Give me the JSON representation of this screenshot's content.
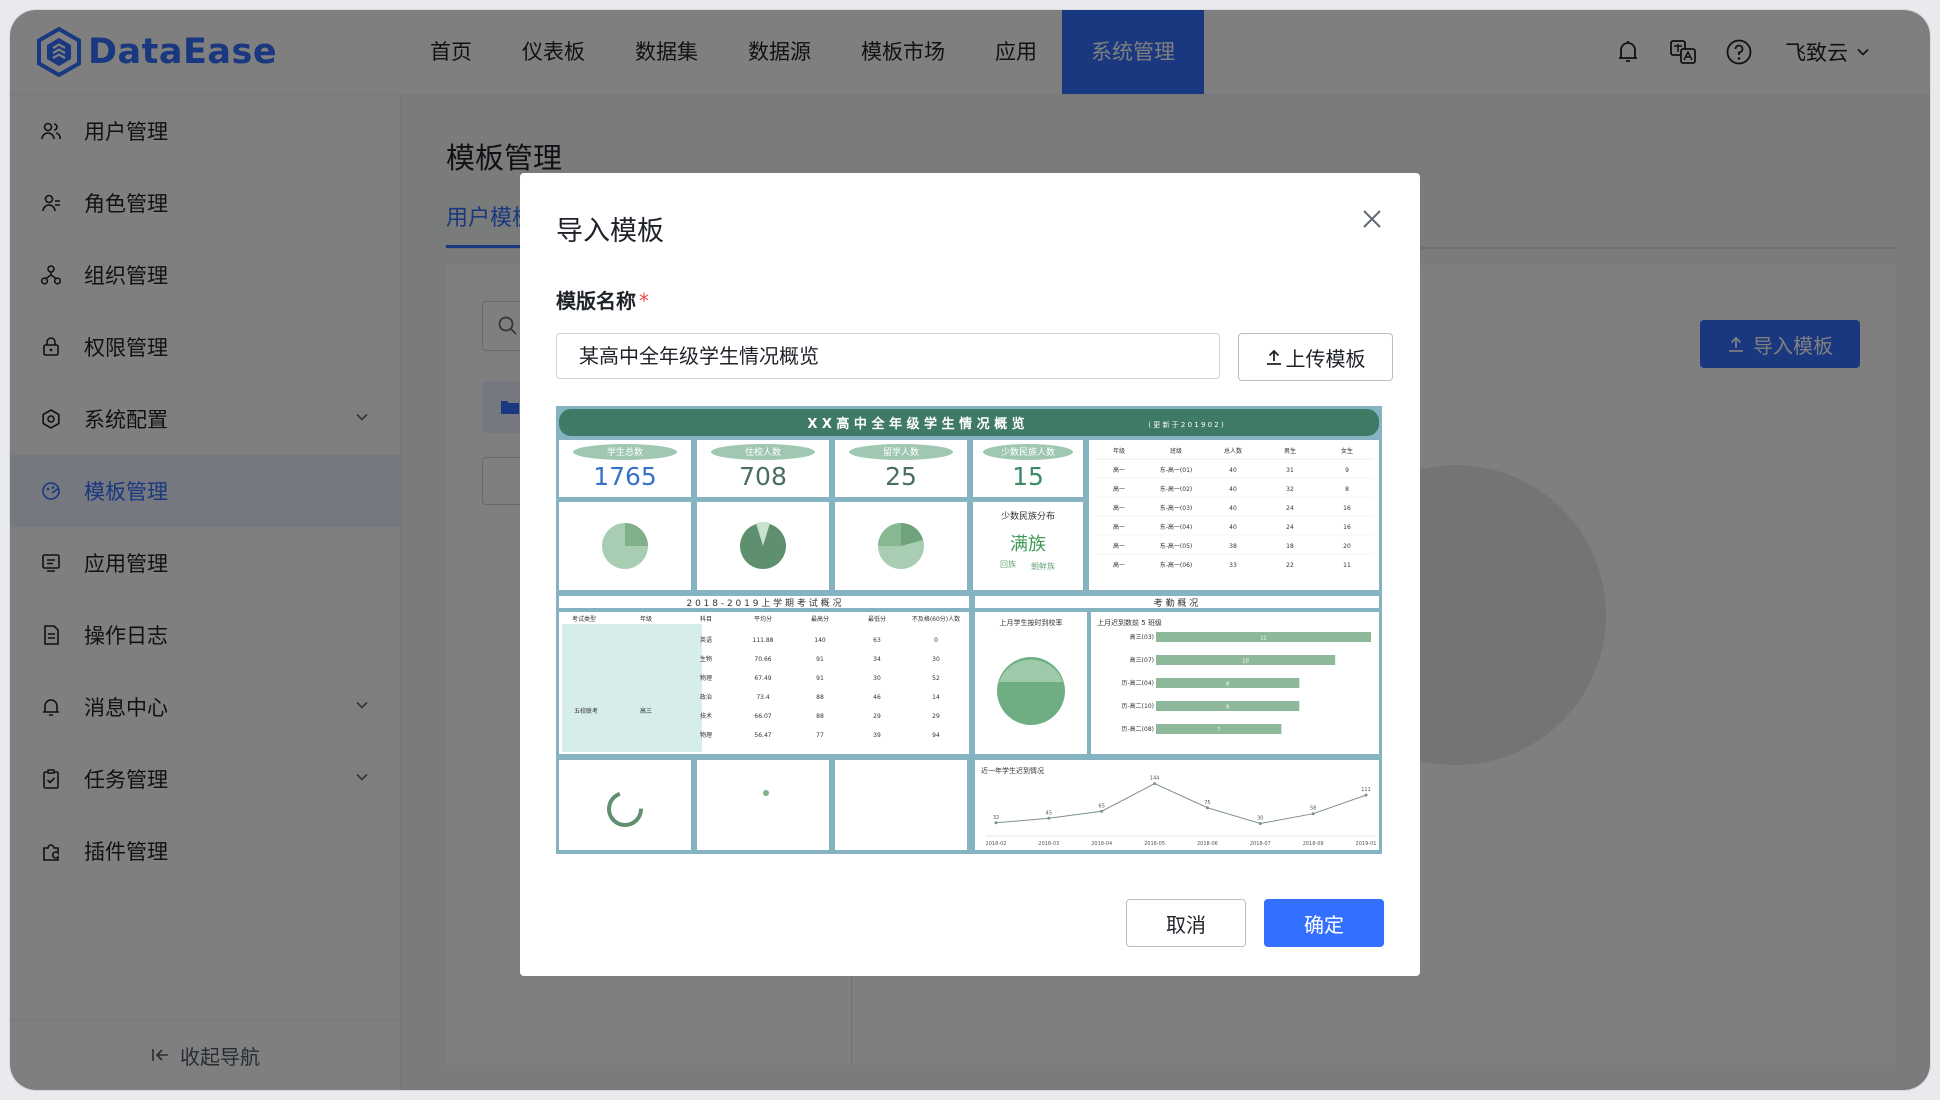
{
  "app": {
    "logo_text": "DataEase"
  },
  "nav": {
    "items": [
      "首页",
      "仪表板",
      "数据集",
      "数据源",
      "模板市场",
      "应用",
      "系统管理"
    ],
    "active_index": 6
  },
  "header": {
    "user_name": "飞致云"
  },
  "sidebar": {
    "items": [
      {
        "label": "用户管理",
        "icon": "users-icon",
        "chevron": false
      },
      {
        "label": "角色管理",
        "icon": "role-icon",
        "chevron": false
      },
      {
        "label": "组织管理",
        "icon": "org-icon",
        "chevron": false
      },
      {
        "label": "权限管理",
        "icon": "lock-icon",
        "chevron": false
      },
      {
        "label": "系统配置",
        "icon": "gear-icon",
        "chevron": true
      },
      {
        "label": "模板管理",
        "icon": "template-icon",
        "chevron": false
      },
      {
        "label": "应用管理",
        "icon": "app-icon",
        "chevron": false
      },
      {
        "label": "操作日志",
        "icon": "log-icon",
        "chevron": false
      },
      {
        "label": "消息中心",
        "icon": "bell-icon",
        "chevron": true
      },
      {
        "label": "任务管理",
        "icon": "task-icon",
        "chevron": true
      },
      {
        "label": "插件管理",
        "icon": "plugin-icon",
        "chevron": false
      }
    ],
    "active_index": 5,
    "collapse_label": "收起导航"
  },
  "main": {
    "page_title": "模板管理",
    "first_tab_label": "用户模板",
    "import_button_label": "导入模板"
  },
  "dialog": {
    "title": "导入模板",
    "field_label": "模版名称",
    "field_value": "某高中全年级学生情况概览",
    "upload_label": "上传模板",
    "cancel_label": "取消",
    "confirm_label": "确定",
    "preview": {
      "title": "X X 高 中 全 年 级 学 生 情 况 概 览",
      "subtitle": "( 更 新 于 2 0 1 9 0 2 )",
      "kpis": [
        {
          "label": "学生总数",
          "value": "1765"
        },
        {
          "label": "住校人数",
          "value": "708"
        },
        {
          "label": "留学人数",
          "value": "25"
        },
        {
          "label": "少数民族人数",
          "value": "15"
        }
      ],
      "minority_title": "少数民族分布",
      "minority_main": "满族",
      "minority_others": [
        "回族",
        "朝鲜族"
      ],
      "class_table": {
        "headers": [
          "年级",
          "班级",
          "总人数",
          "男生",
          "女生"
        ],
        "rows": [
          [
            "高一",
            "东-高一(01)",
            "40",
            "31",
            "9"
          ],
          [
            "高一",
            "东-高一(02)",
            "40",
            "32",
            "8"
          ],
          [
            "高一",
            "东-高一(03)",
            "40",
            "24",
            "16"
          ],
          [
            "高一",
            "东-高一(04)",
            "40",
            "24",
            "16"
          ],
          [
            "高一",
            "东-高一(05)",
            "38",
            "18",
            "20"
          ],
          [
            "高一",
            "东-高一(06)",
            "33",
            "22",
            "11"
          ]
        ]
      },
      "exam_section_title": "2 0 1 8 - 2 0 1 9 上 学 期 考 试 概 况",
      "attendance_section_title": "考 勤 概 况",
      "exam_table": {
        "headers": [
          "考试类型",
          "年级",
          "科目",
          "平均分",
          "最高分",
          "最低分",
          "不及格(60分)人数"
        ],
        "exam_type": "五校联考",
        "grade": "高三",
        "rows": [
          [
            "英语",
            "111.88",
            "140",
            "63",
            "0"
          ],
          [
            "生物",
            "70.66",
            "91",
            "34",
            "30"
          ],
          [
            "物理",
            "67.49",
            "91",
            "30",
            "52"
          ],
          [
            "政治",
            "73.4",
            "88",
            "46",
            "14"
          ],
          [
            "技术",
            "66.07",
            "88",
            "29",
            "29"
          ],
          [
            "物理",
            "56.47",
            "77",
            "39",
            "94"
          ]
        ]
      },
      "ontime_title": "上月学生按时到校率",
      "late_top_title": "上月迟到数前 5 班级",
      "late_top": {
        "categories": [
          "高三(03)",
          "高三(07)",
          "历-高二(04)",
          "历-高二(10)",
          "历-高二(08)"
        ],
        "values": [
          12,
          10,
          8,
          8,
          7
        ]
      },
      "late_trend_title": "近一年学生迟到情况",
      "late_trend": {
        "x": [
          "2018-02",
          "2018-03",
          "2018-04",
          "2018-05",
          "2018-06",
          "2018-07",
          "2018-09",
          "2019-01"
        ],
        "values": [
          32,
          45,
          65,
          144,
          75,
          30,
          58,
          111
        ]
      }
    }
  }
}
